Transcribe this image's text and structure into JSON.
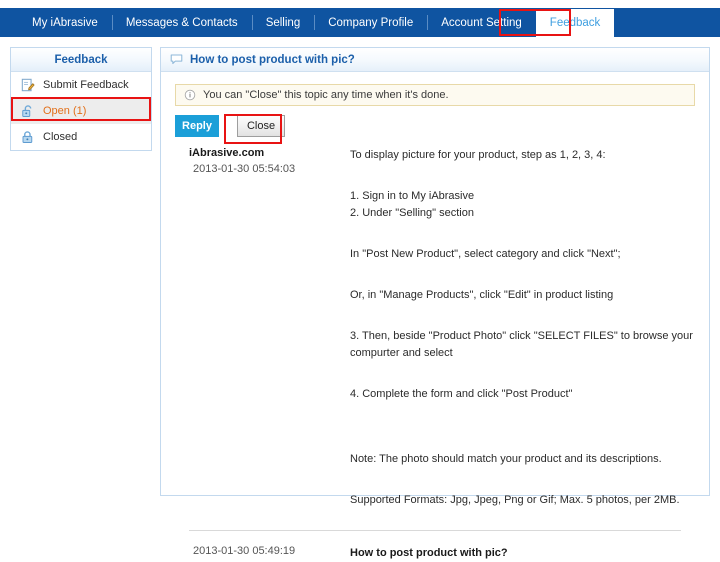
{
  "topnav": {
    "items": [
      {
        "label": "My iAbrasive",
        "active": false
      },
      {
        "label": "Messages & Contacts",
        "active": false
      },
      {
        "label": "Selling",
        "active": false
      },
      {
        "label": "Company Profile",
        "active": false
      },
      {
        "label": "Account Setting",
        "active": false
      },
      {
        "label": "Feedback",
        "active": true
      }
    ],
    "active_color": "#3f9fe0",
    "bar_color": "#0f54a1",
    "highlight_color": "#e81313"
  },
  "sidebar": {
    "header": "Feedback",
    "items": [
      {
        "label": "Submit Feedback",
        "icon": "notepad-pencil-icon",
        "selected": false
      },
      {
        "label": "Open (1)",
        "icon": "unlocked-padlock-icon",
        "selected": true
      },
      {
        "label": "Closed",
        "icon": "locked-padlock-icon",
        "selected": false
      }
    ],
    "selected_color": "#e2701a"
  },
  "main": {
    "title": "How to post product with pic?",
    "title_icon": "speech-bubble-icon",
    "notice": {
      "icon": "info-circle-icon",
      "text": "You can \"Close\" this topic any time when it's done."
    },
    "buttons": {
      "reply": "Reply",
      "close": "Close",
      "reply_color": "#1b9fd8"
    },
    "posts": [
      {
        "author": "iAbrasive.com",
        "timestamp": "2013-01-30 05:54:03",
        "paragraphs": [
          "To display picture for your product, step as 1, 2, 3, 4:",
          "1. Sign in to My iAbrasive",
          "2. Under \"Selling\" section",
          "In \"Post New Product\", select category and click \"Next\";",
          "Or, in \"Manage Products\", click \"Edit\" in product listing",
          "3. Then, beside \"Product Photo\" click \"SELECT FILES\" to browse your compurter and select",
          "4. Complete the form and click \"Post Product\"",
          "Note: The photo should match your product and its descriptions.",
          "Supported Formats: Jpg, Jpeg, Png or Gif; Max. 5 photos, per 2MB."
        ]
      },
      {
        "author": "",
        "timestamp": "2013-01-30 05:49:19",
        "paragraphs": [
          "How to post product with pic?"
        ]
      }
    ]
  }
}
